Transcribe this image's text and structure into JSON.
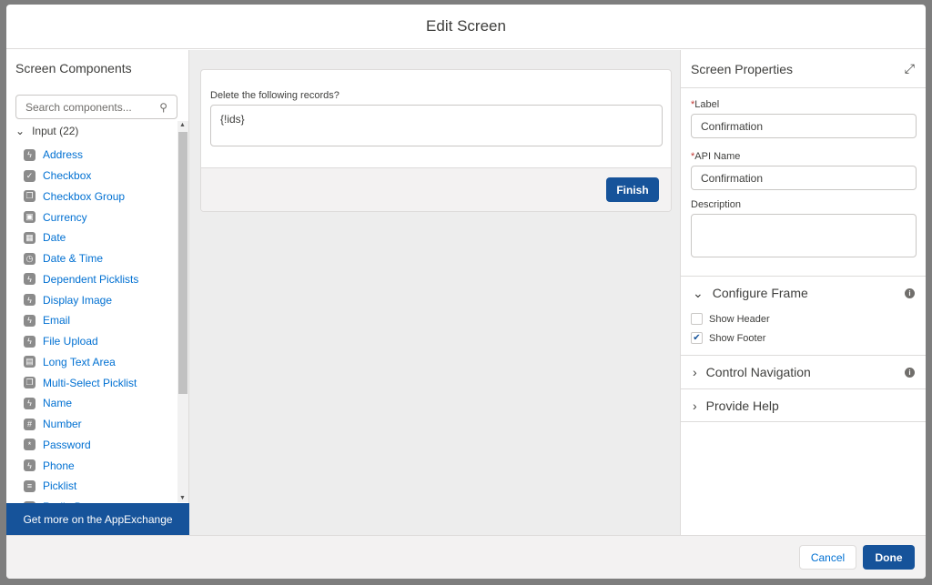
{
  "modal": {
    "title": "Edit Screen"
  },
  "left": {
    "title": "Screen Components",
    "search_placeholder": "Search components...",
    "group": "Input (22)",
    "items": [
      {
        "label": "Address",
        "icon": "bolt-icon"
      },
      {
        "label": "Checkbox",
        "icon": "checkbox-icon"
      },
      {
        "label": "Checkbox Group",
        "icon": "checkbox-group-icon"
      },
      {
        "label": "Currency",
        "icon": "currency-icon"
      },
      {
        "label": "Date",
        "icon": "calendar-icon"
      },
      {
        "label": "Date & Time",
        "icon": "datetime-icon"
      },
      {
        "label": "Dependent Picklists",
        "icon": "bolt-icon"
      },
      {
        "label": "Display Image",
        "icon": "bolt-icon"
      },
      {
        "label": "Email",
        "icon": "bolt-icon"
      },
      {
        "label": "File Upload",
        "icon": "bolt-icon"
      },
      {
        "label": "Long Text Area",
        "icon": "textarea-icon"
      },
      {
        "label": "Multi-Select Picklist",
        "icon": "multiselect-icon"
      },
      {
        "label": "Name",
        "icon": "bolt-icon"
      },
      {
        "label": "Number",
        "icon": "number-icon"
      },
      {
        "label": "Password",
        "icon": "password-icon"
      },
      {
        "label": "Phone",
        "icon": "bolt-icon"
      },
      {
        "label": "Picklist",
        "icon": "list-icon"
      },
      {
        "label": "Radio Buttons",
        "icon": "radio-icon"
      }
    ],
    "appexchange": "Get more on the AppExchange"
  },
  "canvas": {
    "prompt": "Delete the following records?",
    "value": "{!ids}",
    "finish": "Finish"
  },
  "right": {
    "title": "Screen Properties",
    "label_label": "Label",
    "label_value": "Confirmation",
    "api_label": "API Name",
    "api_value": "Confirmation",
    "desc_label": "Description",
    "desc_value": "",
    "configure": "Configure Frame",
    "show_header": "Show Header",
    "show_header_checked": false,
    "show_footer": "Show Footer",
    "show_footer_checked": true,
    "control_nav": "Control Navigation",
    "help": "Provide Help"
  },
  "footer": {
    "cancel": "Cancel",
    "done": "Done"
  },
  "colors": {
    "brand": "#16539a",
    "link": "#0070d2"
  }
}
